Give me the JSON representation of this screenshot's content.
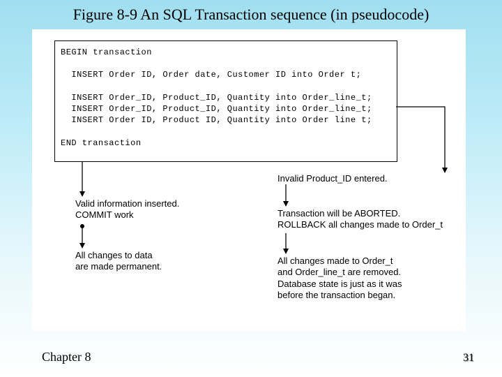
{
  "title": "Figure 8-9 An SQL Transaction sequence (in pseudocode)",
  "code": {
    "begin": "BEGIN transaction",
    "l1": "  INSERT Order ID, Order date, Customer ID into Order t;",
    "l2": "  INSERT Order_ID, Product_ID, Quantity into Order_line_t;",
    "l3": "  INSERT Order_ID, Product_ID, Quantity into Order_line_t;",
    "l4": "  INSERT Order ID, Product ID, Quantity into Order line t;",
    "end": "END transaction"
  },
  "left": {
    "ann1_a": "Valid information inserted.",
    "ann1_b": "COMMIT work",
    "ann2_a": "All changes to data",
    "ann2_b": "are made permanent."
  },
  "right": {
    "ann1": "Invalid Product_ID entered.",
    "ann2_a": "Transaction will be ABORTED.",
    "ann2_b": "ROLLBACK all changes made to Order_t",
    "ann3_a": "All changes made to Order_t",
    "ann3_b": "and Order_line_t are removed.",
    "ann3_c": "Database state is just as it was",
    "ann3_d": "before the transaction began."
  },
  "footer": {
    "chapter": "Chapter 8",
    "page": "31"
  }
}
